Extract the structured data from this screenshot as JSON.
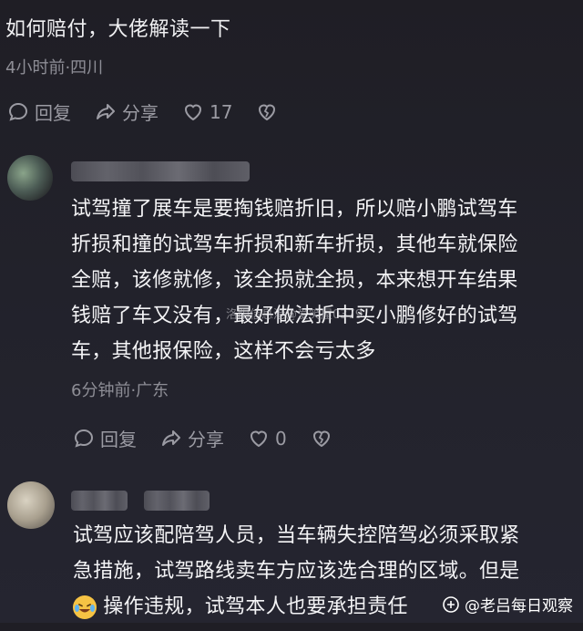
{
  "top_comment": {
    "text": "如何赔付，大佬解读一下",
    "meta": "4小时前·四川",
    "actions": {
      "reply": "回复",
      "share": "分享",
      "likes": "17"
    }
  },
  "comment1": {
    "text_lines": [
      "试驾撞了展车是要掏钱赔折旧，所以赔小鹏试驾车",
      "折损和撞的试驾车折损和新车折损，其他车就保险",
      "全赔，该修就修，该全损就全损，本来想开车结果",
      "钱赔了车又没有，最好做法折中买小鹏修好的试驾",
      "车，其他报保险，这样不会亏太多"
    ],
    "meta": "6分钟前·广东",
    "actions": {
      "reply": "回复",
      "share": "分享",
      "likes": "0"
    },
    "watermark": "洛阳信息港@爱笑屋0379"
  },
  "comment2": {
    "text_lines": [
      "试驾应该配陪驾人员，当车辆失控陪驾必须采取紧",
      "急措施，试驾路线卖车方应该选合理的区域。但是",
      "操作违规，试驾本人也要承担责任"
    ],
    "emoji": "laughing-crying-emoji"
  },
  "footer_watermark": "@老吕每日观察",
  "colors": {
    "background": "#22222b",
    "text": "#f2f2f4",
    "muted": "#8e8e96"
  }
}
